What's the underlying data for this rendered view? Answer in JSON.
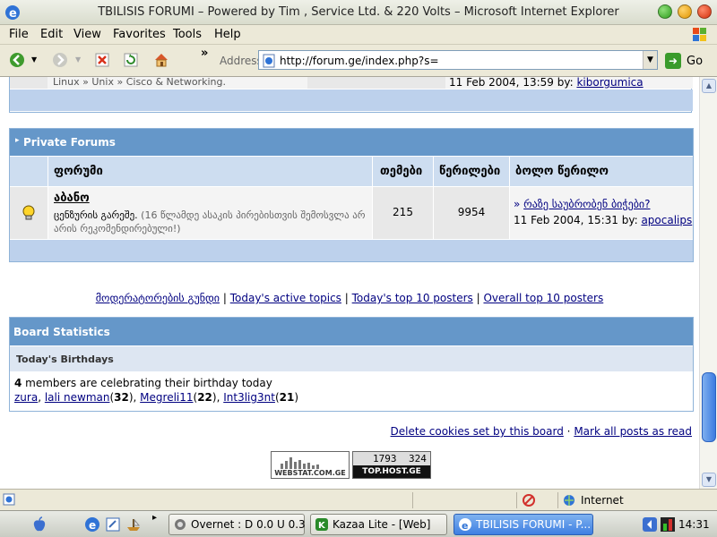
{
  "window": {
    "title": "TBILISIS FORUMI – Powered by Tim , Service Ltd. & 220 Volts – Microsoft Internet Explorer"
  },
  "menu": [
    "File",
    "Edit",
    "View",
    "Favorites",
    "Tools",
    "Help"
  ],
  "toolbar": {
    "address_label": "Address",
    "url": "http://forum.ge/index.php?s=",
    "go_label": "Go",
    "chevron": "»"
  },
  "top_section": {
    "breadcrumb_parts": [
      "Linux",
      "Unix",
      "Cisco & Networking."
    ],
    "breadcrumb_sep": "»",
    "last_post_date": "11 Feb 2004, 13:59",
    "by_label": "by:",
    "last_post_user": "kiborgumica"
  },
  "private_forums": {
    "title": "Private Forums",
    "headers": {
      "forum": "ფორუმი",
      "topics": "თემები",
      "posts": "წერილები",
      "last_post": "ბოლო წერილო"
    },
    "row": {
      "name": "აბანო",
      "desc_main": "ცენზურის გარეშე.",
      "desc_note": "(16 წლამდე ასაკის პირებისთვის შემოსვლა არ არის რეკომენდირებული!)",
      "topics": "215",
      "posts": "9954",
      "last_arrow": "»",
      "last_title": "რაზე საუბრობენ ბიჭები?",
      "last_date": "11 Feb 2004, 15:31",
      "by_label": "by:",
      "last_user": "apocalips"
    }
  },
  "links_row": [
    "მოდერატორების გუნდი",
    "Today's active topics",
    "Today's top 10 posters",
    "Overall top 10 posters"
  ],
  "link_sep": "|",
  "board_stats": {
    "title": "Board Statistics",
    "birthdays_title": "Today's Birthdays",
    "count": "4",
    "count_text": " members are celebrating their birthday today",
    "members": [
      {
        "name": "zura",
        "age": ""
      },
      {
        "name": "lali newman",
        "age": "32"
      },
      {
        "name": "Megreli11",
        "age": "22"
      },
      {
        "name": "Int3lig3nt",
        "age": "21"
      }
    ]
  },
  "bottom_links": {
    "delete_cookies": "Delete cookies set by this board",
    "dot": "·",
    "mark_read": "Mark all posts as read"
  },
  "counters": {
    "webstat_label": "WEBSTAT.COM.GE",
    "tophost_num1": "1793",
    "tophost_num2": "324",
    "tophost_label": "TOP.HOST.GE"
  },
  "statusbar": {
    "zone": "Internet"
  },
  "taskbar": {
    "tasks": [
      {
        "label": "Overnet : D 0.0 U 0.3",
        "active": false
      },
      {
        "label": "Kazaa Lite - [Web]",
        "active": false
      },
      {
        "label": "TBILISIS FORUMI - P...",
        "active": true
      }
    ],
    "clock": "14:31"
  }
}
